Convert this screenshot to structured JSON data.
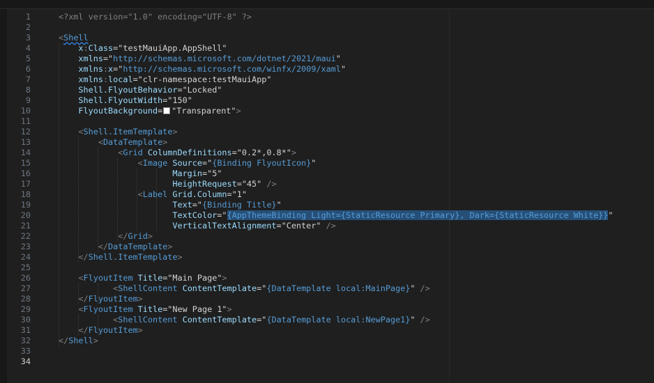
{
  "editor": {
    "language": "xml",
    "lines": [
      {
        "n": "1",
        "tokens": [
          [
            "decl",
            "<?xml version=\"1.0\" encoding=\"UTF-8\" ?>"
          ]
        ]
      },
      {
        "n": "2",
        "tokens": []
      },
      {
        "n": "3",
        "tokens": [
          [
            "punc",
            "<"
          ],
          [
            "tag",
            "Shell",
            "squiggle"
          ]
        ]
      },
      {
        "n": "4",
        "tokens": [
          [
            "plain",
            "    "
          ],
          [
            "prefix",
            "x"
          ],
          [
            "punc",
            ":"
          ],
          [
            "attr",
            "Class"
          ],
          [
            "eq",
            "="
          ],
          [
            "str2",
            "\"testMauiApp.AppShell\""
          ]
        ]
      },
      {
        "n": "5",
        "tokens": [
          [
            "plain",
            "    "
          ],
          [
            "attr",
            "xmlns"
          ],
          [
            "eq",
            "="
          ],
          [
            "str2",
            "\""
          ],
          [
            "link",
            "http://schemas.microsoft.com/dotnet/2021/maui"
          ],
          [
            "str2",
            "\""
          ]
        ]
      },
      {
        "n": "6",
        "tokens": [
          [
            "plain",
            "    "
          ],
          [
            "attr",
            "xmlns"
          ],
          [
            "punc",
            ":"
          ],
          [
            "prefix",
            "x"
          ],
          [
            "eq",
            "="
          ],
          [
            "str2",
            "\""
          ],
          [
            "link",
            "http://schemas.microsoft.com/winfx/2009/xaml"
          ],
          [
            "str2",
            "\""
          ]
        ]
      },
      {
        "n": "7",
        "tokens": [
          [
            "plain",
            "    "
          ],
          [
            "attr",
            "xmlns"
          ],
          [
            "punc",
            ":"
          ],
          [
            "prefix",
            "local"
          ],
          [
            "eq",
            "="
          ],
          [
            "str2",
            "\"clr-namespace:testMauiApp\""
          ]
        ]
      },
      {
        "n": "8",
        "tokens": [
          [
            "plain",
            "    "
          ],
          [
            "attr",
            "Shell.FlyoutBehavior"
          ],
          [
            "eq",
            "="
          ],
          [
            "str2",
            "\"Locked\""
          ]
        ]
      },
      {
        "n": "9",
        "tokens": [
          [
            "plain",
            "    "
          ],
          [
            "attr",
            "Shell.FlyoutWidth"
          ],
          [
            "eq",
            "="
          ],
          [
            "str2",
            "\"150\""
          ]
        ]
      },
      {
        "n": "10",
        "tokens": [
          [
            "plain",
            "    "
          ],
          [
            "attr",
            "FlyoutBackground"
          ],
          [
            "eq",
            "="
          ],
          [
            "swatch",
            ""
          ],
          [
            "str2",
            "\"Transparent\""
          ],
          [
            "punc",
            ">"
          ]
        ]
      },
      {
        "n": "11",
        "tokens": []
      },
      {
        "n": "12",
        "tokens": [
          [
            "plain",
            "    "
          ],
          [
            "punc",
            "<"
          ],
          [
            "tag",
            "Shell.ItemTemplate"
          ],
          [
            "punc",
            ">"
          ]
        ]
      },
      {
        "n": "13",
        "tokens": [
          [
            "plain",
            "        "
          ],
          [
            "punc",
            "<"
          ],
          [
            "tag",
            "DataTemplate"
          ],
          [
            "punc",
            ">"
          ]
        ]
      },
      {
        "n": "14",
        "tokens": [
          [
            "plain",
            "            "
          ],
          [
            "punc",
            "<"
          ],
          [
            "tag",
            "Grid "
          ],
          [
            "attr",
            "ColumnDefinitions"
          ],
          [
            "eq",
            "="
          ],
          [
            "str2",
            "\"0.2*,0.8*\""
          ],
          [
            "punc",
            ">"
          ]
        ]
      },
      {
        "n": "15",
        "tokens": [
          [
            "plain",
            "                "
          ],
          [
            "punc",
            "<"
          ],
          [
            "tag",
            "Image "
          ],
          [
            "attr",
            "Source"
          ],
          [
            "eq",
            "="
          ],
          [
            "str2",
            "\""
          ],
          [
            "bind",
            "{Binding FlyoutIcon}"
          ],
          [
            "str2",
            "\""
          ]
        ]
      },
      {
        "n": "16",
        "tokens": [
          [
            "plain",
            "                       "
          ],
          [
            "attr",
            "Margin"
          ],
          [
            "eq",
            "="
          ],
          [
            "str2",
            "\"5\""
          ]
        ]
      },
      {
        "n": "17",
        "tokens": [
          [
            "plain",
            "                       "
          ],
          [
            "attr",
            "HeightRequest"
          ],
          [
            "eq",
            "="
          ],
          [
            "str2",
            "\"45\""
          ],
          [
            "punc",
            " />"
          ]
        ]
      },
      {
        "n": "18",
        "tokens": [
          [
            "plain",
            "                "
          ],
          [
            "punc",
            "<"
          ],
          [
            "tag",
            "Label "
          ],
          [
            "attr",
            "Grid.Column"
          ],
          [
            "eq",
            "="
          ],
          [
            "str2",
            "\"1\""
          ]
        ]
      },
      {
        "n": "19",
        "tokens": [
          [
            "plain",
            "                       "
          ],
          [
            "attr",
            "Text"
          ],
          [
            "eq",
            "="
          ],
          [
            "str2",
            "\""
          ],
          [
            "bind",
            "{Binding Title}"
          ],
          [
            "str2",
            "\""
          ]
        ]
      },
      {
        "n": "20",
        "tokens": [
          [
            "plain",
            "                       "
          ],
          [
            "attr",
            "TextColor"
          ],
          [
            "eq",
            "="
          ],
          [
            "str2",
            "\""
          ],
          [
            "bindsel",
            "{AppThemeBinding Light={StaticResource Primary}, Dark={StaticResource White}}"
          ],
          [
            "str2",
            "\""
          ]
        ]
      },
      {
        "n": "21",
        "tokens": [
          [
            "plain",
            "                       "
          ],
          [
            "attr",
            "VerticalTextAlignment"
          ],
          [
            "eq",
            "="
          ],
          [
            "str2",
            "\"Center\""
          ],
          [
            "punc",
            " />"
          ]
        ]
      },
      {
        "n": "22",
        "tokens": [
          [
            "plain",
            "            "
          ],
          [
            "punc",
            "</"
          ],
          [
            "tag",
            "Grid"
          ],
          [
            "punc",
            ">"
          ]
        ]
      },
      {
        "n": "23",
        "tokens": [
          [
            "plain",
            "        "
          ],
          [
            "punc",
            "</"
          ],
          [
            "tag",
            "DataTemplate"
          ],
          [
            "punc",
            ">"
          ]
        ]
      },
      {
        "n": "24",
        "tokens": [
          [
            "plain",
            "    "
          ],
          [
            "punc",
            "</"
          ],
          [
            "tag",
            "Shell.ItemTemplate"
          ],
          [
            "punc",
            ">"
          ]
        ]
      },
      {
        "n": "25",
        "tokens": []
      },
      {
        "n": "26",
        "tokens": [
          [
            "plain",
            "    "
          ],
          [
            "punc",
            "<"
          ],
          [
            "tag",
            "FlyoutItem "
          ],
          [
            "attr",
            "Title"
          ],
          [
            "eq",
            "="
          ],
          [
            "str2",
            "\"Main Page\""
          ],
          [
            "punc",
            ">"
          ]
        ]
      },
      {
        "n": "27",
        "tokens": [
          [
            "plain",
            "           "
          ],
          [
            "punc",
            "<"
          ],
          [
            "tag",
            "ShellContent "
          ],
          [
            "attr",
            "ContentTemplate"
          ],
          [
            "eq",
            "="
          ],
          [
            "str2",
            "\""
          ],
          [
            "bind",
            "{DataTemplate local:MainPage}"
          ],
          [
            "str2",
            "\""
          ],
          [
            "punc",
            " />"
          ]
        ]
      },
      {
        "n": "28",
        "tokens": [
          [
            "plain",
            "    "
          ],
          [
            "punc",
            "</"
          ],
          [
            "tag",
            "FlyoutItem"
          ],
          [
            "punc",
            ">"
          ]
        ]
      },
      {
        "n": "29",
        "tokens": [
          [
            "plain",
            "    "
          ],
          [
            "punc",
            "<"
          ],
          [
            "tag",
            "FlyoutItem "
          ],
          [
            "attr",
            "Title"
          ],
          [
            "eq",
            "="
          ],
          [
            "str2",
            "\"New Page 1\""
          ],
          [
            "punc",
            ">"
          ]
        ]
      },
      {
        "n": "30",
        "tokens": [
          [
            "plain",
            "           "
          ],
          [
            "punc",
            "<"
          ],
          [
            "tag",
            "ShellContent "
          ],
          [
            "attr",
            "ContentTemplate"
          ],
          [
            "eq",
            "="
          ],
          [
            "str2",
            "\""
          ],
          [
            "bind",
            "{DataTemplate local:NewPage1}"
          ],
          [
            "str2",
            "\""
          ],
          [
            "punc",
            " />"
          ]
        ]
      },
      {
        "n": "31",
        "tokens": [
          [
            "plain",
            "    "
          ],
          [
            "punc",
            "</"
          ],
          [
            "tag",
            "FlyoutItem"
          ],
          [
            "punc",
            ">"
          ]
        ]
      },
      {
        "n": "32",
        "tokens": [
          [
            "punc",
            "</"
          ],
          [
            "tag",
            "Shell"
          ],
          [
            "punc",
            ">"
          ]
        ]
      },
      {
        "n": "33",
        "tokens": []
      },
      {
        "n": "34",
        "tokens": []
      }
    ]
  },
  "colors": {
    "background": "#1f1f1f",
    "line_number": "#6e7681",
    "tag": "#569cd6",
    "attribute": "#9cdcfe",
    "string": "#d4d4d4",
    "binding": "#569cd6",
    "selection": "#264f78"
  }
}
